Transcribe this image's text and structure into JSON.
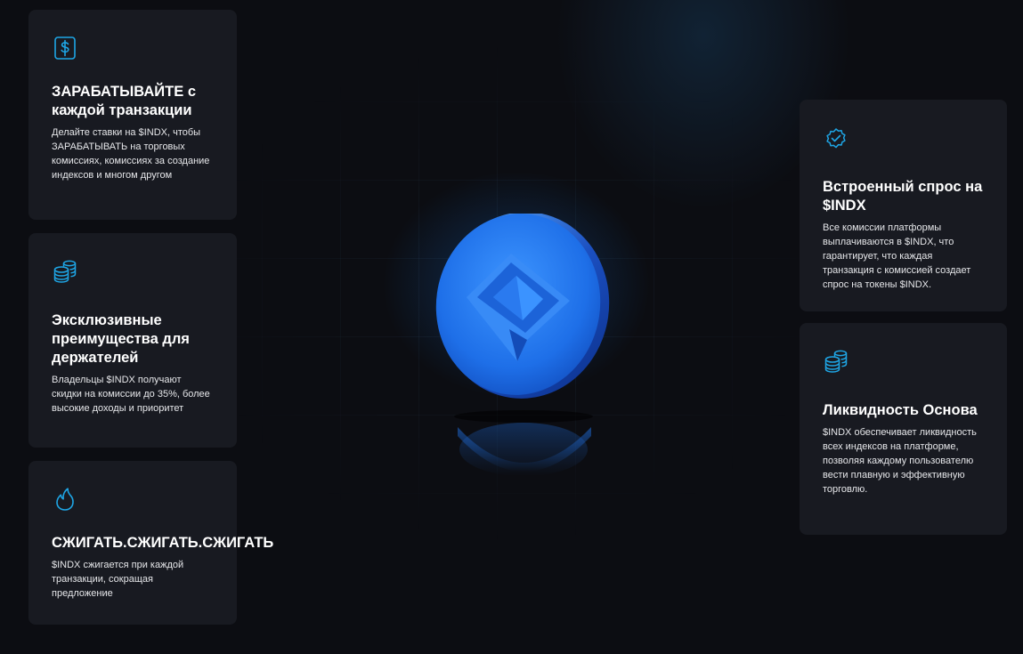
{
  "colors": {
    "background": "#0c0d12",
    "card": "#181a21",
    "accent": "#1ea6e6",
    "coin": "#1f7cf0"
  },
  "features_left": [
    {
      "icon": "dollar-icon",
      "title": "ЗАРАБАТЫВАЙТЕ с каждой транзакции",
      "text": "Делайте ставки на $INDX, чтобы ЗАРАБАТЫВАТЬ на торговых комиссиях, комиссиях за создание индексов и многом другом"
    },
    {
      "icon": "coins-stack-icon",
      "title": "Эксклюзивные преимущества для держателей",
      "text": "Владельцы $INDX получают скидки на комиссии до 35%, более высокие доходы и приоритет"
    },
    {
      "icon": "flame-icon",
      "title": "СЖИГАТЬ.СЖИГАТЬ.СЖИГАТЬ",
      "text": "$INDX сжигается при каждой транзакции, сокращая предложение"
    }
  ],
  "features_right": [
    {
      "icon": "verified-badge-icon",
      "title": "Встроенный спрос на $INDX",
      "text": "Все комиссии платформы выплачиваются в $INDX, что гарантирует, что каждая транзакция с комиссией создает спрос на токены $INDX."
    },
    {
      "icon": "coins-stack-icon",
      "title": "Ликвидность Основа",
      "text": "$INDX обеспечивает ликвидность всех индексов на платформе, позволяя каждому пользователю вести плавную и эффективную торговлю."
    }
  ],
  "center": {
    "image": "indx-coin-logo"
  }
}
